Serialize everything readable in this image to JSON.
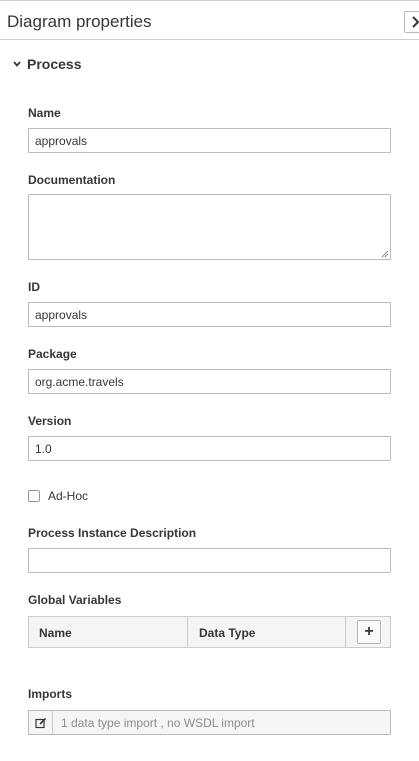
{
  "panel": {
    "title": "Diagram properties"
  },
  "section": {
    "title": "Process"
  },
  "fields": {
    "name": {
      "label": "Name",
      "value": "approvals"
    },
    "documentation": {
      "label": "Documentation",
      "value": ""
    },
    "id": {
      "label": "ID",
      "value": "approvals"
    },
    "package": {
      "label": "Package",
      "value": "org.acme.travels"
    },
    "version": {
      "label": "Version",
      "value": "1.0"
    },
    "adhoc": {
      "label": "Ad-Hoc",
      "checked": false
    },
    "process_instance_description": {
      "label": "Process Instance Description",
      "value": ""
    }
  },
  "global_variables": {
    "label": "Global Variables",
    "columns": [
      "Name",
      "Data Type"
    ],
    "add_label": "+"
  },
  "imports": {
    "label": "Imports",
    "summary": "1 data type import , no WSDL import"
  }
}
